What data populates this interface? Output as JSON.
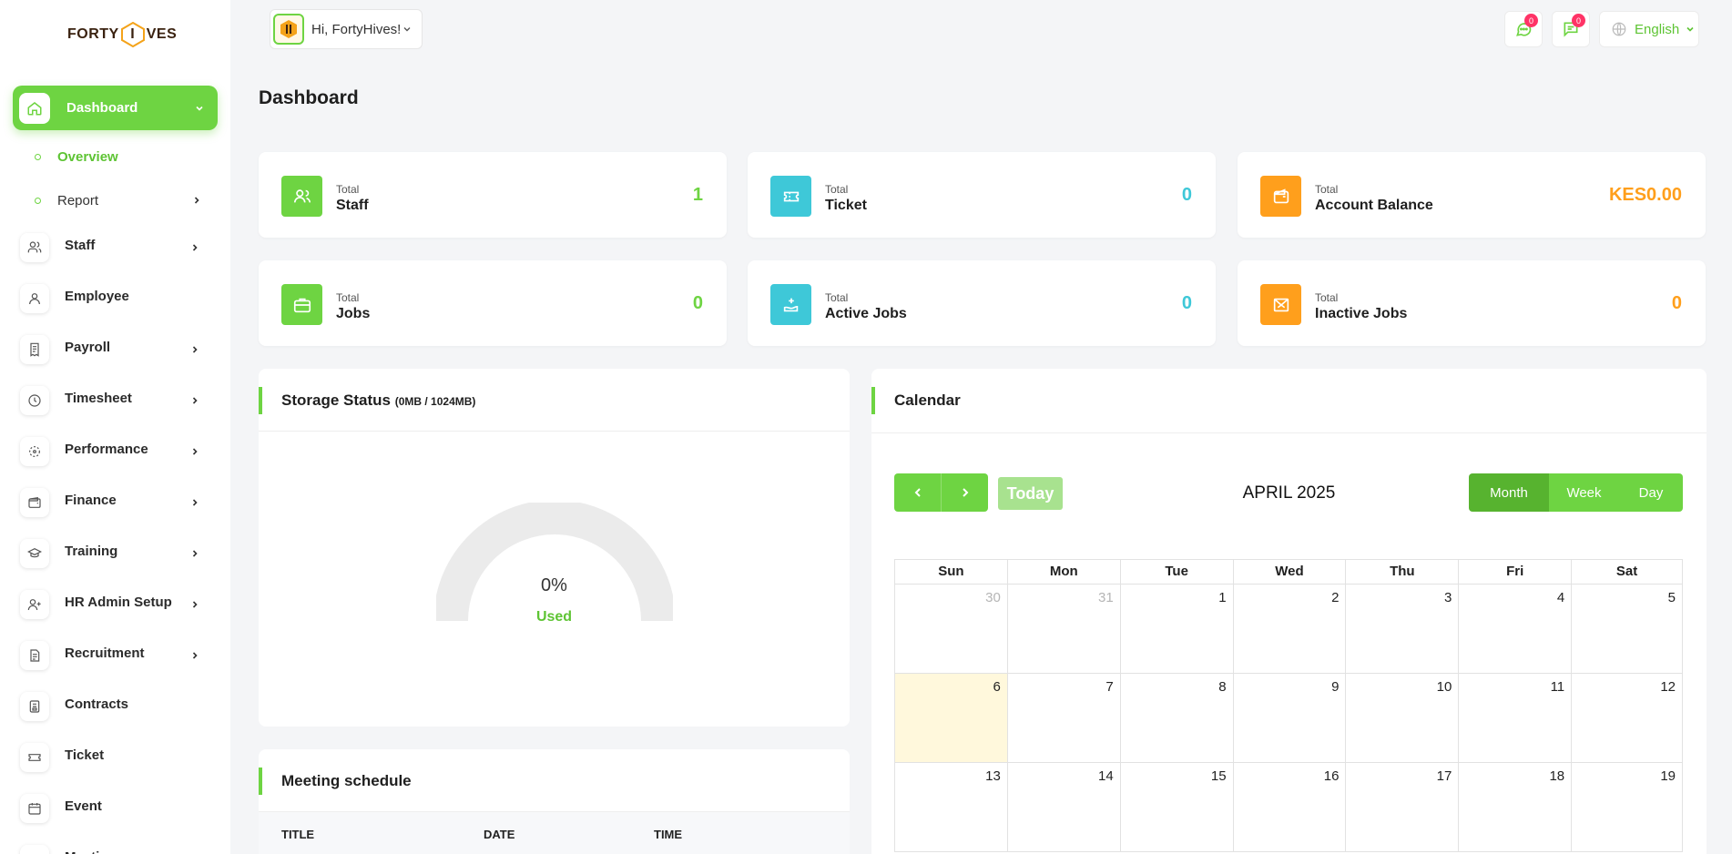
{
  "brand": {
    "logo_left": "FORTY",
    "logo_mid": "I",
    "logo_right": "VES",
    "accent": "#6ed442"
  },
  "sidebar": {
    "active": {
      "label": "Dashboard"
    },
    "sub_items": [
      {
        "label": "Overview"
      },
      {
        "label": "Report"
      }
    ],
    "items": [
      {
        "label": "Staff",
        "icon": "users-icon",
        "chevron": true
      },
      {
        "label": "Employee",
        "icon": "user-icon",
        "chevron": false
      },
      {
        "label": " Payroll",
        "icon": "receipt-icon",
        "chevron": true
      },
      {
        "label": "Timesheet",
        "icon": "clock-icon",
        "chevron": true
      },
      {
        "label": "Performance",
        "icon": "performance-icon",
        "chevron": true
      },
      {
        "label": "Finance",
        "icon": "wallet-icon",
        "chevron": true
      },
      {
        "label": "Training",
        "icon": "graduation-cap-icon",
        "chevron": true
      },
      {
        "label": " HR Admin Setup",
        "icon": "user-plus-icon",
        "chevron": true
      },
      {
        "label": "Recruitment",
        "icon": "document-icon",
        "chevron": true
      },
      {
        "label": "Contracts",
        "icon": "contract-icon",
        "chevron": false
      },
      {
        "label": "Ticket",
        "icon": "ticket-icon",
        "chevron": false
      },
      {
        "label": "Event",
        "icon": "calendar-icon",
        "chevron": false
      },
      {
        "label": "Meeting",
        "icon": "meeting-icon",
        "chevron": false
      }
    ]
  },
  "topbar": {
    "greeting": "Hi, FortyHives!",
    "chat_badge": "0",
    "messages_badge": "0",
    "language": "English"
  },
  "page": {
    "title": "Dashboard"
  },
  "stats": [
    {
      "small": "Total",
      "label": "Staff",
      "value": "1",
      "color": "#6ed442"
    },
    {
      "small": "Total",
      "label": "Ticket",
      "value": "0",
      "color": "#3ec8d8"
    },
    {
      "small": "Total",
      "label": "Account Balance",
      "value": "KES0.00",
      "color": "#ff9f1c"
    },
    {
      "small": "Total",
      "label": "Jobs",
      "value": "0",
      "color": "#6ed442"
    },
    {
      "small": "Total",
      "label": "Active Jobs",
      "value": "0",
      "color": "#3ec8d8"
    },
    {
      "small": "Total",
      "label": "Inactive Jobs",
      "value": "0",
      "color": "#ff9f1c"
    }
  ],
  "storage": {
    "title": "Storage Status",
    "subtitle": "(0MB / 1024MB)",
    "percent_text": "0%",
    "used_label": "Used",
    "used_fraction": 0
  },
  "meeting": {
    "title": "Meeting schedule",
    "columns": [
      "TITLE",
      "DATE",
      "TIME"
    ]
  },
  "calendar": {
    "title": "Calendar",
    "month_label": "APRIL 2025",
    "today_label": "Today",
    "views": [
      "Month",
      "Week",
      "Day"
    ],
    "active_view": "Month",
    "weekdays": [
      "Sun",
      "Mon",
      "Tue",
      "Wed",
      "Thu",
      "Fri",
      "Sat"
    ],
    "weeks": [
      [
        {
          "d": "30",
          "other": true
        },
        {
          "d": "31",
          "other": true
        },
        {
          "d": "1"
        },
        {
          "d": "2"
        },
        {
          "d": "3"
        },
        {
          "d": "4"
        },
        {
          "d": "5"
        }
      ],
      [
        {
          "d": "6",
          "today": true
        },
        {
          "d": "7"
        },
        {
          "d": "8"
        },
        {
          "d": "9"
        },
        {
          "d": "10"
        },
        {
          "d": "11"
        },
        {
          "d": "12"
        }
      ],
      [
        {
          "d": "13"
        },
        {
          "d": "14"
        },
        {
          "d": "15"
        },
        {
          "d": "16"
        },
        {
          "d": "17"
        },
        {
          "d": "18"
        },
        {
          "d": "19"
        }
      ]
    ]
  }
}
